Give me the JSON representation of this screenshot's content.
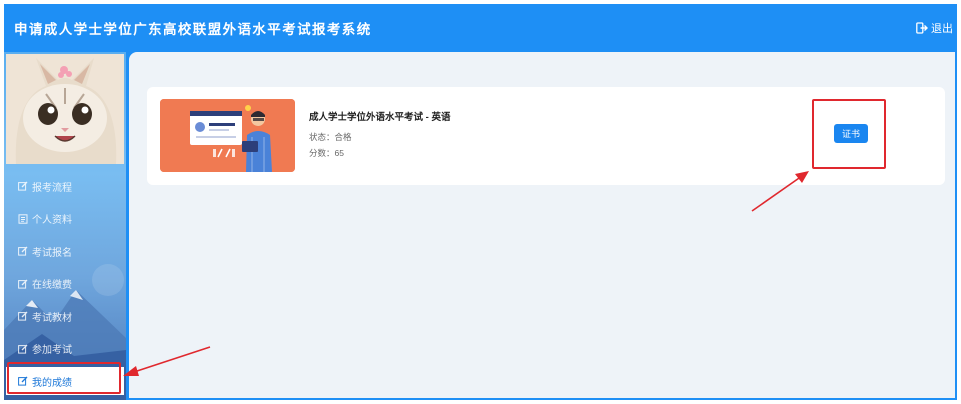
{
  "header": {
    "title": "申请成人学士学位广东高校联盟外语水平考试报考系统",
    "logout_label": "退出"
  },
  "sidebar": {
    "items": [
      {
        "label": "报考流程"
      },
      {
        "label": "个人资料"
      },
      {
        "label": "考试报名"
      },
      {
        "label": "在线缴费"
      },
      {
        "label": "考试教材"
      },
      {
        "label": "参加考试"
      },
      {
        "label": "我的成绩"
      }
    ],
    "active_index": 6
  },
  "exam": {
    "title": "成人学士学位外语水平考试 - 英语",
    "status_text": "状态：合格",
    "score_text": "分数：65",
    "certificate_label": "证书"
  },
  "annotations": {
    "highlight_color": "#e0282e"
  },
  "colors": {
    "primary": "#1e8ff5",
    "content_bg": "#eef3f8",
    "thumb_bg": "#f07a52"
  }
}
